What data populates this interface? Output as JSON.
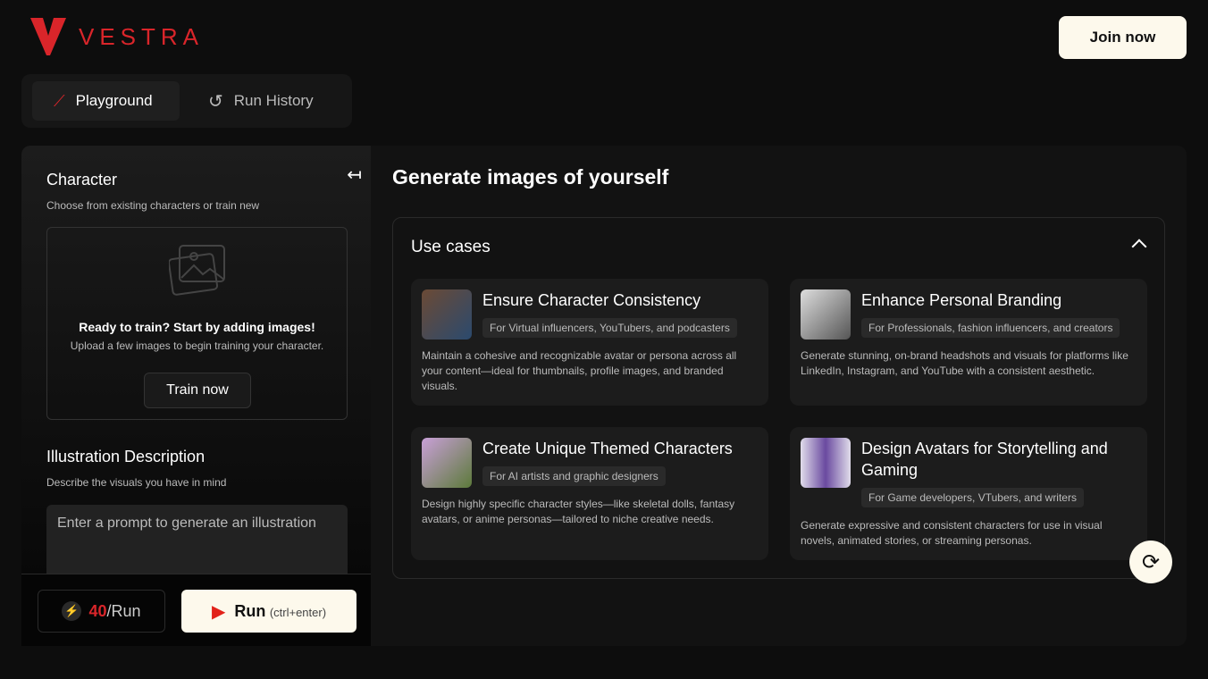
{
  "brand": {
    "name": "VESTRA"
  },
  "header": {
    "join_label": "Join now"
  },
  "tabs": [
    {
      "label": "Playground",
      "icon": "magic-wand-icon"
    },
    {
      "label": "Run History",
      "icon": "history-icon"
    }
  ],
  "character": {
    "title": "Character",
    "subtitle": "Choose from existing characters or train new",
    "empty_title": "Ready to train? Start by adding images!",
    "empty_sub": "Upload a few images to begin training your character.",
    "train_label": "Train now"
  },
  "illustration": {
    "title": "Illustration Description",
    "subtitle": "Describe the visuals you have in mind",
    "placeholder": "Enter a prompt to generate an illustration"
  },
  "footer": {
    "cost": "40",
    "cost_suffix": "/Run",
    "run_label": "Run",
    "run_hint": "(ctrl+enter)"
  },
  "main": {
    "title": "Generate images of yourself",
    "use_cases_title": "Use cases",
    "cards": [
      {
        "title": "Ensure Character Consistency",
        "tag": "For Virtual influencers, YouTubers, and podcasters",
        "desc": "Maintain a cohesive and recognizable avatar or persona across all your content—ideal for thumbnails, profile images, and branded visuals."
      },
      {
        "title": "Enhance Personal Branding",
        "tag": "For Professionals, fashion influencers, and creators",
        "desc": "Generate stunning, on-brand headshots and visuals for platforms like LinkedIn, Instagram, and YouTube with a consistent aesthetic."
      },
      {
        "title": "Create Unique Themed Characters",
        "tag": "For AI artists and graphic designers",
        "desc": "Design highly specific character styles—like skeletal dolls, fantasy avatars, or anime personas—tailored to niche creative needs."
      },
      {
        "title": "Design Avatars for Storytelling and Gaming",
        "tag": "For Game developers, VTubers, and writers",
        "desc": "Generate expressive and consistent characters for use in visual novels, animated stories, or streaming personas."
      }
    ]
  },
  "colors": {
    "accent": "#d9252a",
    "cream": "#fdf9ec"
  }
}
